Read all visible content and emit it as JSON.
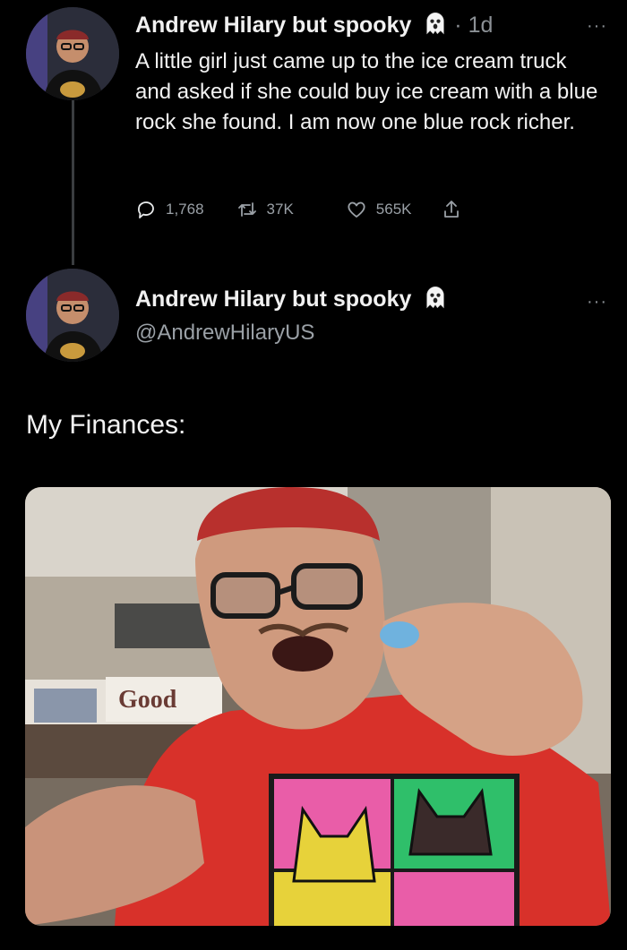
{
  "tweet": {
    "author_name": "Andrew Hilary but spooky",
    "separator": "·",
    "time": "1d",
    "more": "···",
    "text": "A little girl just came up to the ice cream truck and asked if she could buy ice cream with a blue rock she found. I am now one blue rock richer.",
    "stats": {
      "replies": "1,768",
      "retweets": "37K",
      "likes": "565K"
    }
  },
  "quote": {
    "author_name": "Andrew Hilary but spooky",
    "handle": "@AndrewHilaryUS",
    "more": "···",
    "caption": "My Finances:",
    "photo_sign_text": "Good"
  },
  "icons": {
    "ghost": "ghost-emoji-icon",
    "reply": "reply-icon",
    "retweet": "retweet-icon",
    "like": "heart-icon",
    "share": "share-icon"
  },
  "colors": {
    "background": "#000000",
    "text": "#e7e9ea",
    "secondary": "#8b9095"
  }
}
